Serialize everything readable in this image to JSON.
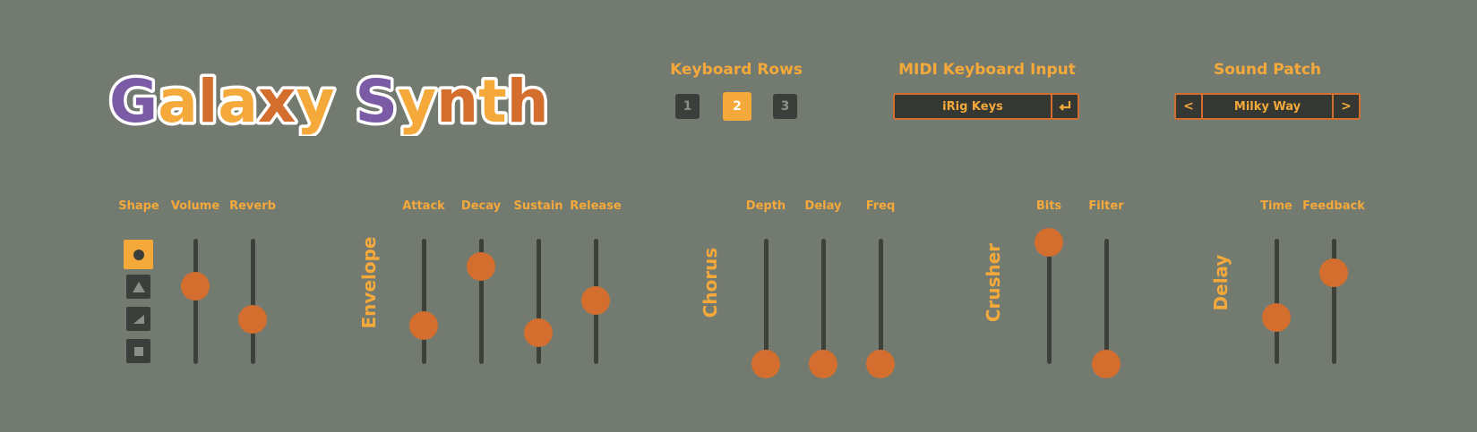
{
  "app": {
    "title": "Galaxy Synth"
  },
  "header": {
    "keyboard_rows": {
      "label": "Keyboard Rows",
      "options": [
        "1",
        "2",
        "3"
      ],
      "selected": "2"
    },
    "midi_input": {
      "label": "MIDI Keyboard Input",
      "value": "iRig Keys",
      "enter_icon": "return-icon"
    },
    "sound_patch": {
      "label": "Sound Patch",
      "prev": "<",
      "value": "Milky Way",
      "next": ">"
    }
  },
  "sections": {
    "envelope": "Envelope",
    "chorus": "Chorus",
    "crusher": "Crusher",
    "delay": "Delay"
  },
  "shape": {
    "label": "Shape",
    "options": [
      "circle-icon",
      "triangle-icon",
      "sawtooth-icon",
      "square-icon"
    ],
    "selected": "circle-icon"
  },
  "sliders": [
    {
      "label": "Volume",
      "value": 0.62
    },
    {
      "label": "Reverb",
      "value": 0.36
    },
    {
      "label": "Attack",
      "value": 0.31
    },
    {
      "label": "Decay",
      "value": 0.78
    },
    {
      "label": "Sustain",
      "value": 0.25
    },
    {
      "label": "Release",
      "value": 0.51
    },
    {
      "label": "Depth",
      "value": 0.0
    },
    {
      "label": "Delay",
      "value": 0.0
    },
    {
      "label": "Freq",
      "value": 0.0
    },
    {
      "label": "Bits",
      "value": 0.97
    },
    {
      "label": "Filter",
      "value": 0.0
    },
    {
      "label": "Time",
      "value": 0.37
    },
    {
      "label": "Feedback",
      "value": 0.73
    }
  ],
  "colors": {
    "background": "#737a70",
    "accent_yellow": "#f5a93a",
    "accent_orange": "#d36e2e",
    "logo_purple": "#7b5aa6",
    "dark": "#3b3e3a"
  }
}
